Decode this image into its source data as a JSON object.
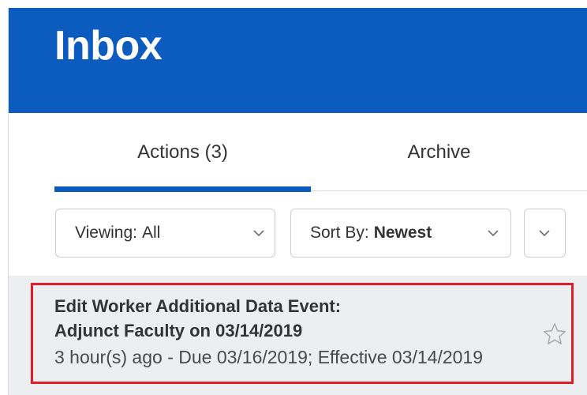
{
  "header": {
    "title": "Inbox",
    "background": "#0c5cc0"
  },
  "tabs": [
    {
      "label": "Actions (3)",
      "active": true
    },
    {
      "label": "Archive",
      "active": false
    }
  ],
  "filters": {
    "viewing": {
      "label": "Viewing:",
      "value": "All"
    },
    "sort": {
      "label": "Sort By:",
      "value": "Newest"
    }
  },
  "inbox_item": {
    "title_line1": "Edit Worker Additional Data Event:",
    "title_line2": "Adjunct Faculty on 03/14/2019",
    "meta": "3 hour(s) ago - Due 03/16/2019; Effective 03/14/2019",
    "highlight_color": "#e11d2a",
    "starred": false
  },
  "icons": [
    "chevron-down-icon",
    "star-icon"
  ]
}
